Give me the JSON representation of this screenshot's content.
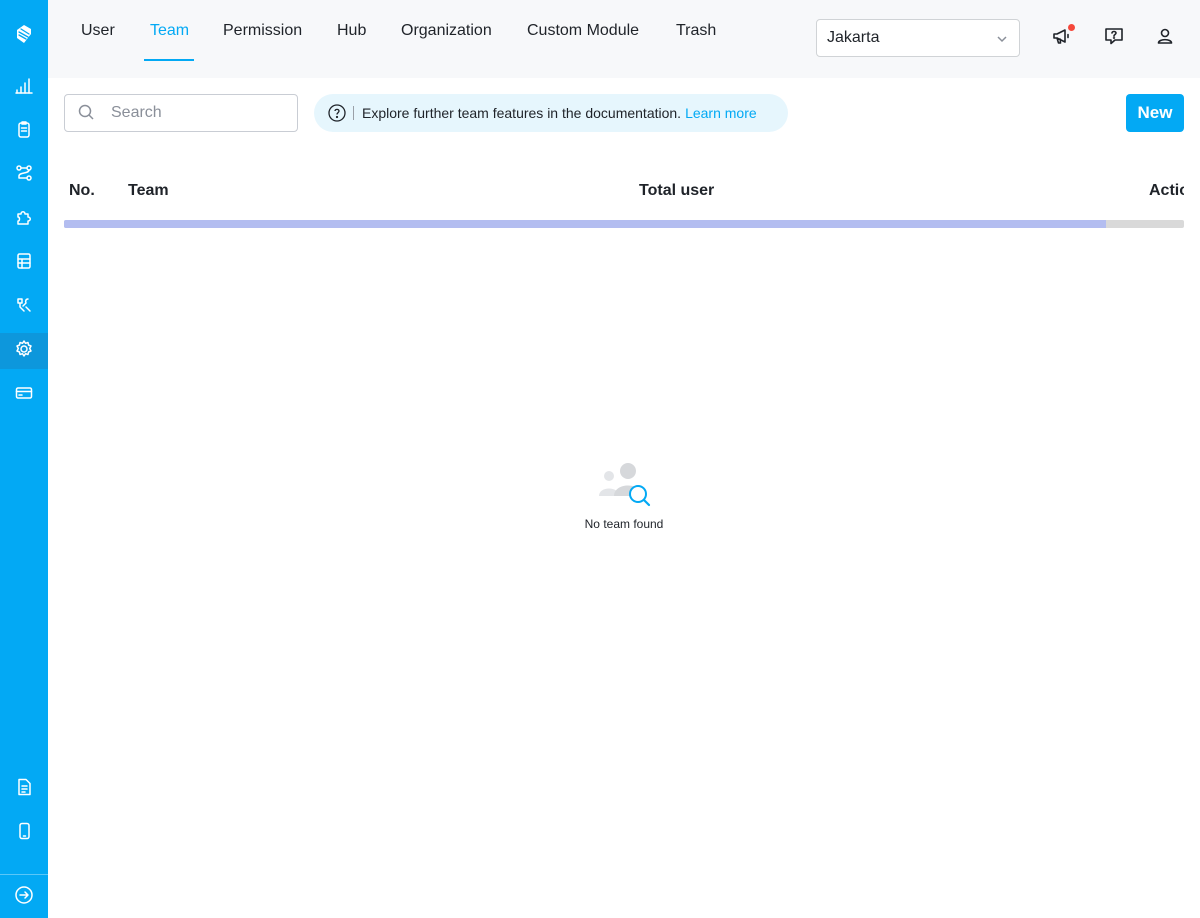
{
  "sidebar": {
    "items": [
      {
        "icon": "logo-icon"
      },
      {
        "icon": "bar-chart-icon"
      },
      {
        "icon": "clipboard-icon"
      },
      {
        "icon": "workflow-icon"
      },
      {
        "icon": "puzzle-icon"
      },
      {
        "icon": "table-icon"
      },
      {
        "icon": "tools-icon"
      },
      {
        "icon": "gear-icon",
        "active": true
      },
      {
        "icon": "credit-card-icon"
      },
      {
        "icon": "document-icon"
      },
      {
        "icon": "mobile-icon"
      },
      {
        "icon": "collapse-arrow-icon"
      }
    ]
  },
  "header": {
    "tabs": [
      {
        "label": "User"
      },
      {
        "label": "Team",
        "active": true
      },
      {
        "label": "Permission"
      },
      {
        "label": "Hub"
      },
      {
        "label": "Organization"
      },
      {
        "label": "Custom Module"
      },
      {
        "label": "Trash"
      }
    ],
    "location_select": {
      "value": "Jakarta"
    },
    "icons": [
      "announcement-icon",
      "help-icon",
      "user-icon"
    ]
  },
  "toolbar": {
    "search_placeholder": "Search",
    "info_text": "Explore further team features in the documentation.",
    "info_link": "Learn more",
    "new_button": "New"
  },
  "table": {
    "columns": [
      "No.",
      "Team",
      "Total user",
      "Actio"
    ],
    "loading_progress": 0.93
  },
  "empty_state": {
    "message": "No team found"
  },
  "colors": {
    "accent": "#03a9f4",
    "sidebar_active": "#0d97dc",
    "progress_fill": "#b3bdf0",
    "notification_dot": "#f5483b"
  }
}
